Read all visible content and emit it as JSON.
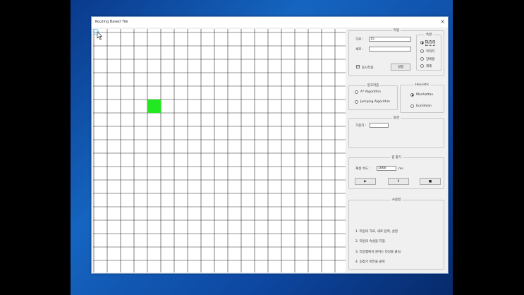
{
  "window": {
    "title": "Routing Based Tile",
    "close_glyph": "×"
  },
  "grid": {
    "filled_cells": [
      {
        "col": 4,
        "row": 5,
        "color": "#22e822"
      }
    ]
  },
  "map_panel": {
    "legend": "타일",
    "width_label": "가로 :",
    "width_value": "15",
    "height_label": "세로 :",
    "height_value": "",
    "sync_label": "동시작용",
    "sync_checked": true,
    "apply_label": "설정",
    "attr_legend": "속성",
    "attr_options": [
      "출발지",
      "목적지",
      "장애물",
      "해제"
    ],
    "attr_selected": 0
  },
  "algo_panel": {
    "legend": "알고리즘",
    "options": [
      "A* Algorithm",
      "Jumping Algorithm"
    ],
    "selected": -1
  },
  "heuristic_panel": {
    "legend": "Heuristic",
    "options": [
      "Manhattan",
      "Euclidean"
    ],
    "selected": 0
  },
  "cost_panel": {
    "legend": "옵션",
    "weight_label": "가중치 :",
    "weight_value": ""
  },
  "run_panel": {
    "legend": "길 찾기",
    "speed_label": "재생 속도 :",
    "speed_value": "1000",
    "speed_unit": "ms",
    "play_glyph": "▶",
    "pause_glyph": "II",
    "stop_glyph": "■"
  },
  "help_panel": {
    "legend": "사용법",
    "lines": [
      "1. 타일의 가로, 세로 입력, 설정",
      "2. 타일의 속성을 지정.",
      "3. 타일맵에서 원하는 타일을 클릭.",
      "4. 길찾기 버튼을 클릭"
    ]
  }
}
